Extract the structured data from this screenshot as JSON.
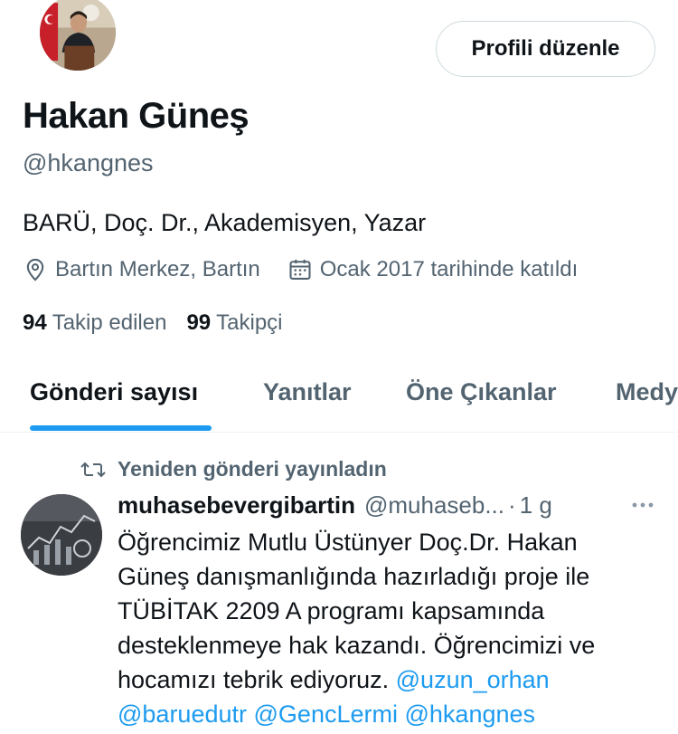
{
  "profile": {
    "display_name": "Hakan Güneş",
    "handle": "@hkangnes",
    "bio": "BARÜ, Doç. Dr., Akademisyen, Yazar",
    "location": "Bartın Merkez, Bartın",
    "joined": "Ocak 2017 tarihinde katıldı",
    "following_count": "94",
    "following_label": "Takip edilen",
    "followers_count": "99",
    "followers_label": "Takipçi",
    "edit_button_label": "Profili düzenle"
  },
  "tabs": [
    {
      "label": "Gönderi sayısı",
      "active": true
    },
    {
      "label": "Yanıtlar",
      "active": false
    },
    {
      "label": "Öne Çıkanlar",
      "active": false
    },
    {
      "label": "Medya",
      "active": false
    }
  ],
  "post": {
    "repost_label": "Yeniden gönderi yayınladın",
    "author": "muhasebevergibartin",
    "author_handle": "@muhaseb...",
    "separator": "·",
    "time": "1 g",
    "text_lines": [
      "Öğrencimiz Mutlu Üstünyer  Doç.Dr. Hakan",
      "Güneş danışmanlığında hazırladığı proje ile",
      "TÜBİTAK 2209 A  programı kapsamında",
      "desteklenmeye hak kazandı. Öğrencimizi ve",
      "hocamızı  tebrik ediyoruz. "
    ],
    "mentions": [
      "@uzun_orhan",
      "@baruedutr",
      "@GencLermi",
      "@hkangnes"
    ]
  },
  "icons": {
    "location": "location-pin-icon",
    "calendar": "calendar-icon",
    "repost": "repost-icon",
    "more": "more-dots-icon"
  },
  "colors": {
    "accent": "#1d9bf0",
    "text_primary": "#0f1419",
    "text_secondary": "#536471",
    "border": "#cfd9de"
  }
}
